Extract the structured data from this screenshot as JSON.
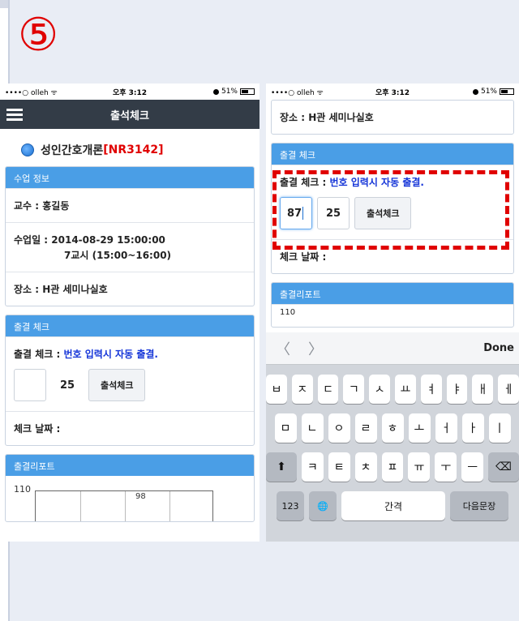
{
  "slide": {
    "step_number": "⑤"
  },
  "left_phone": {
    "status": {
      "carrier": "••••○ olleh ᯤ",
      "time": "오후 3:12",
      "battery": "51%"
    },
    "nav_title": "출석체크",
    "course_name": "성인간호개론",
    "course_code": "[NR3142]",
    "info_header": "수업 정보",
    "professor": "교수 : 홍길동",
    "class_date": "수업일 : 2014-08-29 15:00:00",
    "class_period": "7교시 (15:00~16:00)",
    "location": "장소 : H관 세미나실호",
    "check_header": "출결 체크",
    "check_label": "출결 체크 : ",
    "check_note": "번호 입력시 자동 출결.",
    "input1_value": "",
    "input2_value": "25",
    "check_button": "출석체크",
    "check_date": "체크 날짜 :",
    "report_header": "출결리포트",
    "chart_y_value": "110",
    "chart_bar_value": "98"
  },
  "right_phone": {
    "status": {
      "carrier": "••••○ olleh ᯤ",
      "time": "오후 3:12",
      "battery": "51%"
    },
    "location": "장소 : H관 세미나실호",
    "check_header": "출결 체크",
    "check_label": "출결 체크 : ",
    "check_note": "번호 입력시 자동 출결.",
    "input1_value": "87",
    "input2_value": "25",
    "check_button": "출석체크",
    "check_date": "체크 날짜 :",
    "report_header": "출결리포트",
    "report_partial": "110",
    "keyboard": {
      "prev": "〈",
      "next": "〉",
      "done": "Done",
      "row1": [
        "ㅂ",
        "ㅈ",
        "ㄷ",
        "ㄱ",
        "ㅅ",
        "ㅛ",
        "ㅕ",
        "ㅑ",
        "ㅐ",
        "ㅔ"
      ],
      "row2": [
        "ㅁ",
        "ㄴ",
        "ㅇ",
        "ㄹ",
        "ㅎ",
        "ㅗ",
        "ㅓ",
        "ㅏ",
        "ㅣ"
      ],
      "row3": [
        "ㅋ",
        "ㅌ",
        "ㅊ",
        "ㅍ",
        "ㅠ",
        "ㅜ",
        "ㅡ"
      ],
      "shift": "⬆",
      "delete": "⌫",
      "numbers": "123",
      "globe": "🌐",
      "space": "간격",
      "return": "다음문장"
    }
  }
}
